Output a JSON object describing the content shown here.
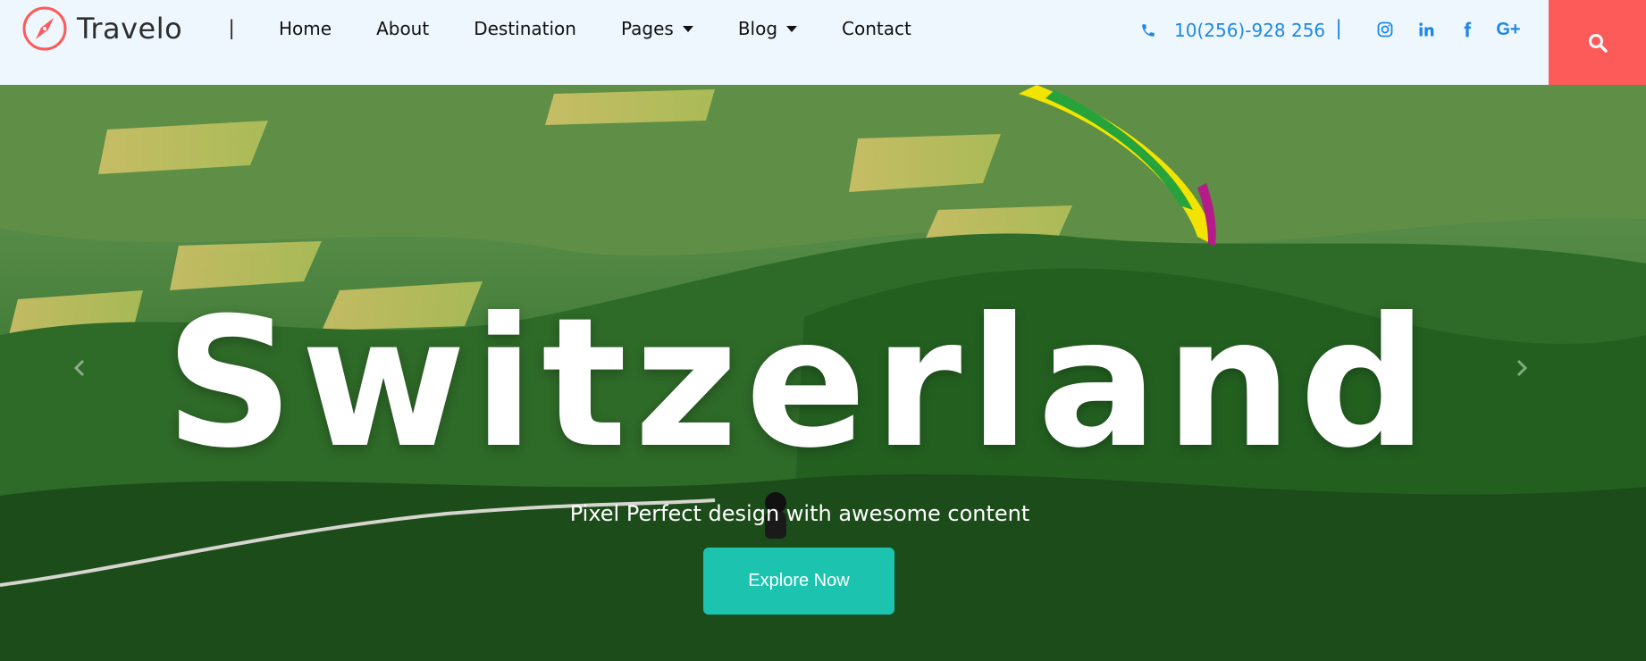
{
  "brand": {
    "name": "Travelo",
    "accent": "#fd5a5a"
  },
  "nav": {
    "items": [
      {
        "label": "Home",
        "dropdown": false
      },
      {
        "label": "About",
        "dropdown": false
      },
      {
        "label": "Destination",
        "dropdown": false
      },
      {
        "label": "Pages",
        "dropdown": true
      },
      {
        "label": "Blog",
        "dropdown": true
      },
      {
        "label": "Contact",
        "dropdown": false
      }
    ]
  },
  "contact": {
    "phone": "10(256)-928 256",
    "icon": "phone-icon",
    "color": "#1f88e5"
  },
  "socials": [
    {
      "name": "instagram-icon"
    },
    {
      "name": "linkedin-icon"
    },
    {
      "name": "facebook-icon"
    },
    {
      "name": "google-plus-icon",
      "label": "G+"
    }
  ],
  "search": {
    "icon": "search-icon",
    "bg": "#fd5a5a"
  },
  "hero": {
    "title": "Switzerland",
    "subtitle": "Pixel Perfect design with awesome content",
    "cta": "Explore Now",
    "cta_color": "#1cc4b0"
  }
}
